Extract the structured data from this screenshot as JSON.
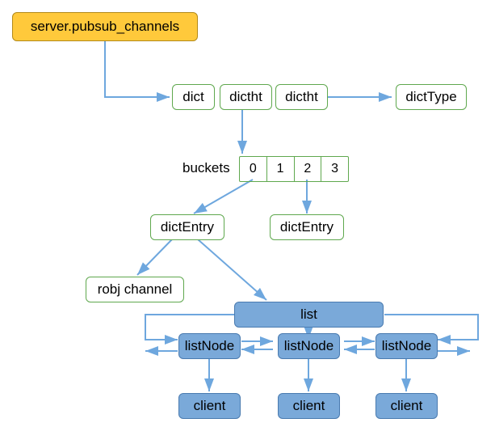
{
  "root": {
    "label": "server.pubsub_channels"
  },
  "row1": {
    "dict": "dict",
    "dictht1": "dictht",
    "dictht2": "dictht",
    "dictType": "dictType"
  },
  "bucketsLabel": "buckets",
  "buckets": [
    "0",
    "1",
    "2",
    "3"
  ],
  "entry1": "dictEntry",
  "entry2": "dictEntry",
  "robj": "robj channel",
  "list": "list",
  "listNode1": "listNode",
  "listNode2": "listNode",
  "listNode3": "listNode",
  "client1": "client",
  "client2": "client",
  "client3": "client"
}
